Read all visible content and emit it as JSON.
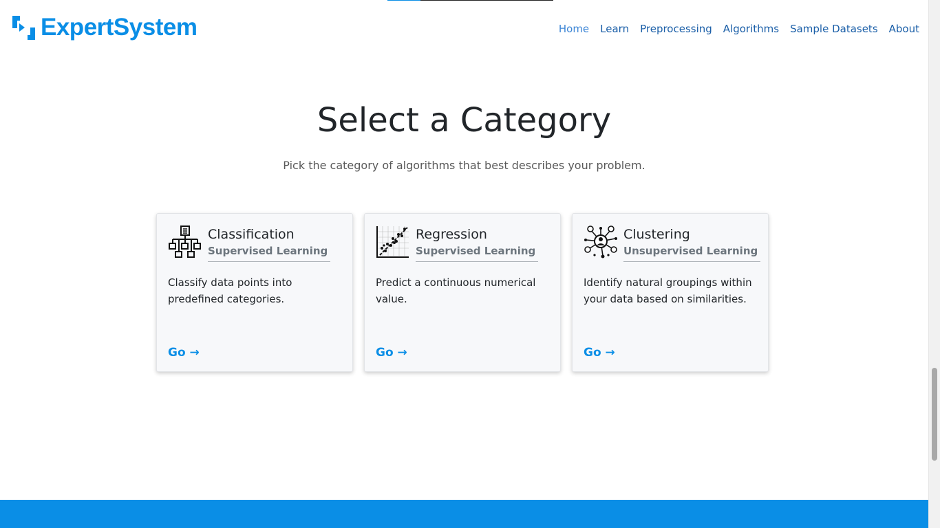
{
  "scroll_progress": 0.2,
  "brand": {
    "name": "ExpertSystem",
    "color": "#0a8ee6"
  },
  "nav": {
    "items": [
      {
        "label": "Home",
        "active": true
      },
      {
        "label": "Learn"
      },
      {
        "label": "Preprocessing"
      },
      {
        "label": "Algorithms"
      },
      {
        "label": "Sample Datasets"
      },
      {
        "label": "About"
      }
    ]
  },
  "hero": {
    "title": "Select a Category",
    "subtitle": "Pick the category of algorithms that best describes your problem."
  },
  "cards": [
    {
      "icon": "hierarchy-icon",
      "title": "Classification",
      "subtitle": "Supervised Learning",
      "description": "Classify data points into predefined categories.",
      "link": "Go →"
    },
    {
      "icon": "scatter-regression-icon",
      "title": "Regression",
      "subtitle": "Supervised Learning",
      "description": "Predict a continuous numerical value.",
      "link": "Go →"
    },
    {
      "icon": "network-cluster-icon",
      "title": "Clustering",
      "subtitle": "Unsupervised Learning",
      "description": "Identify natural groupings within your data based on similarities.",
      "link": "Go →"
    }
  ],
  "colors": {
    "accent": "#0a8ee6",
    "nav_link": "#1b5fa8",
    "footer": "#0a8ee6"
  }
}
